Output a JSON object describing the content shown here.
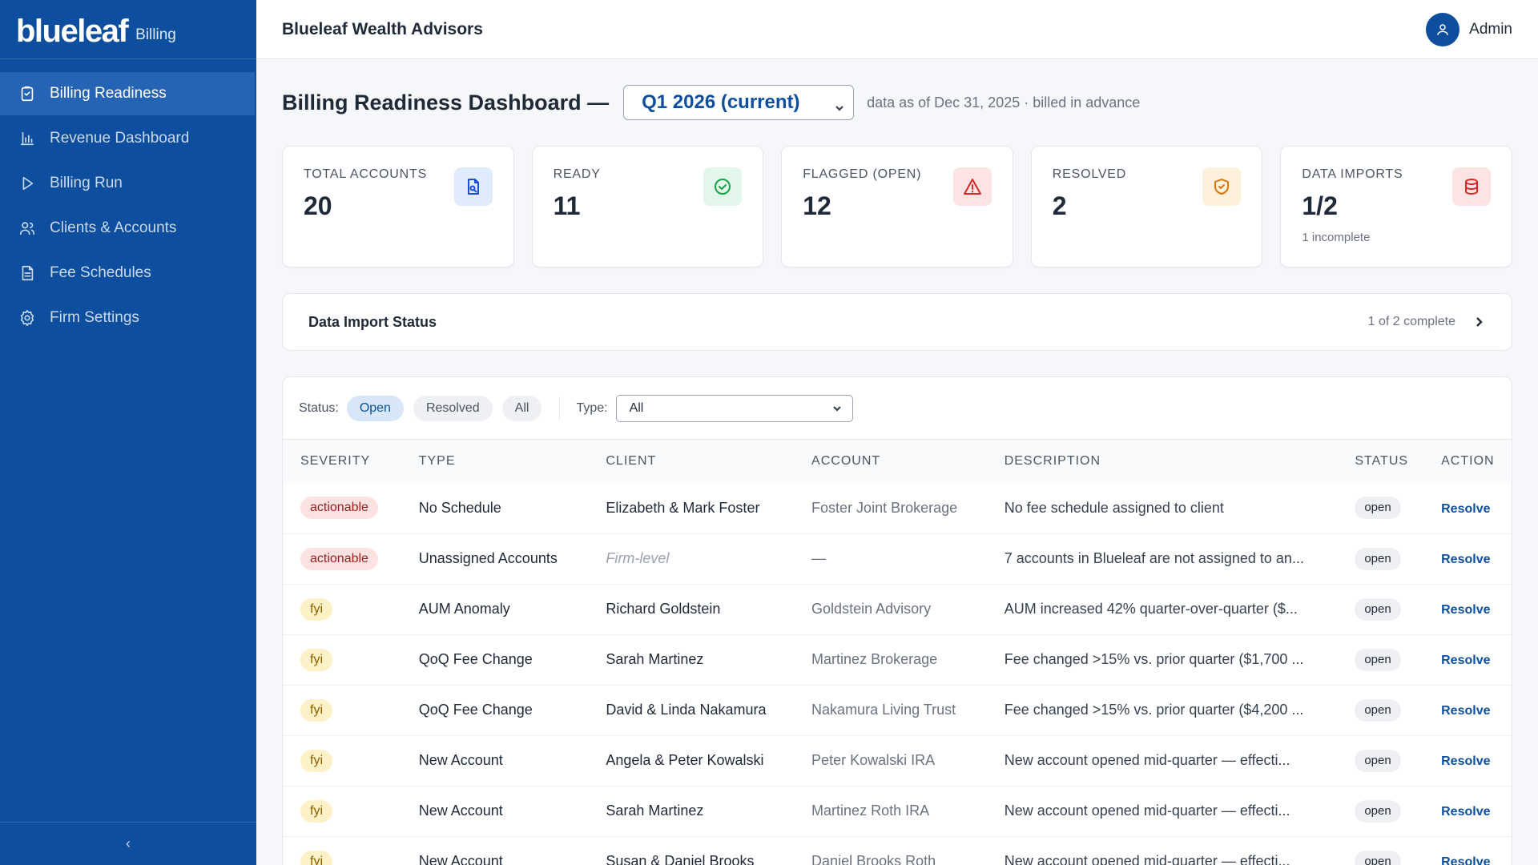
{
  "brand": {
    "logo": "blueleaf",
    "product": "Billing"
  },
  "sidebar": {
    "items": [
      {
        "label": "Billing Readiness",
        "icon": "clipboard-check-icon",
        "active": true
      },
      {
        "label": "Revenue Dashboard",
        "icon": "bar-chart-icon",
        "active": false
      },
      {
        "label": "Billing Run",
        "icon": "play-icon",
        "active": false
      },
      {
        "label": "Clients & Accounts",
        "icon": "users-icon",
        "active": false
      },
      {
        "label": "Fee Schedules",
        "icon": "document-icon",
        "active": false
      },
      {
        "label": "Firm Settings",
        "icon": "gear-icon",
        "active": false
      }
    ],
    "collapse_label": "‹"
  },
  "header": {
    "firm_name": "Blueleaf Wealth Advisors",
    "user_name": "Admin"
  },
  "page": {
    "title": "Billing Readiness Dashboard —",
    "quarter": "Q1 2026 (current)",
    "as_of": "data as of Dec 31, 2025 · billed in advance"
  },
  "cards": [
    {
      "label": "TOTAL ACCOUNTS",
      "value": "20",
      "sub": "",
      "icon": "file-search-icon",
      "color": "#1d4ed8",
      "bg": "#e0ecfb"
    },
    {
      "label": "READY",
      "value": "11",
      "sub": "",
      "icon": "check-circle-icon",
      "color": "#16a34a",
      "bg": "#e3f6ea"
    },
    {
      "label": "FLAGGED (OPEN)",
      "value": "12",
      "sub": "",
      "icon": "alert-triangle-icon",
      "color": "#dc2626",
      "bg": "#fde4e4"
    },
    {
      "label": "RESOLVED",
      "value": "2",
      "sub": "",
      "icon": "shield-check-icon",
      "color": "#d97706",
      "bg": "#fdf0dc"
    },
    {
      "label": "DATA IMPORTS",
      "value": "1/2",
      "sub": "1 incomplete",
      "icon": "database-icon",
      "color": "#dc2626",
      "bg": "#fde4e4"
    }
  ],
  "imports": {
    "title": "Data Import Status",
    "summary": "1 of 2 complete"
  },
  "filters": {
    "status_label": "Status:",
    "status_options": [
      "Open",
      "Resolved",
      "All"
    ],
    "status_selected": "Open",
    "type_label": "Type:",
    "type_value": "All"
  },
  "table": {
    "columns": [
      "SEVERITY",
      "TYPE",
      "CLIENT",
      "ACCOUNT",
      "DESCRIPTION",
      "STATUS",
      "ACTION"
    ],
    "rows": [
      {
        "severity": "actionable",
        "type": "No Schedule",
        "client": "Elizabeth & Mark Foster",
        "account": "Foster Joint Brokerage",
        "description": "No fee schedule assigned to client",
        "status": "open",
        "action": "Resolve"
      },
      {
        "severity": "actionable",
        "type": "Unassigned Accounts",
        "client": "Firm-level",
        "account": "—",
        "description": "7 accounts in Blueleaf are not assigned to an...",
        "status": "open",
        "action": "Resolve"
      },
      {
        "severity": "fyi",
        "type": "AUM Anomaly",
        "client": "Richard Goldstein",
        "account": "Goldstein Advisory",
        "description": "AUM increased 42% quarter-over-quarter ($...",
        "status": "open",
        "action": "Resolve"
      },
      {
        "severity": "fyi",
        "type": "QoQ Fee Change",
        "client": "Sarah Martinez",
        "account": "Martinez Brokerage",
        "description": "Fee changed >15% vs. prior quarter ($1,700 ...",
        "status": "open",
        "action": "Resolve"
      },
      {
        "severity": "fyi",
        "type": "QoQ Fee Change",
        "client": "David & Linda Nakamura",
        "account": "Nakamura Living Trust",
        "description": "Fee changed >15% vs. prior quarter ($4,200 ...",
        "status": "open",
        "action": "Resolve"
      },
      {
        "severity": "fyi",
        "type": "New Account",
        "client": "Angela & Peter Kowalski",
        "account": "Peter Kowalski IRA",
        "description": "New account opened mid-quarter — effecti...",
        "status": "open",
        "action": "Resolve"
      },
      {
        "severity": "fyi",
        "type": "New Account",
        "client": "Sarah Martinez",
        "account": "Martinez Roth IRA",
        "description": "New account opened mid-quarter — effecti...",
        "status": "open",
        "action": "Resolve"
      },
      {
        "severity": "fyi",
        "type": "New Account",
        "client": "Susan & Daniel Brooks",
        "account": "Daniel Brooks Roth",
        "description": "New account opened mid-quarter — effecti...",
        "status": "open",
        "action": "Resolve"
      }
    ]
  }
}
